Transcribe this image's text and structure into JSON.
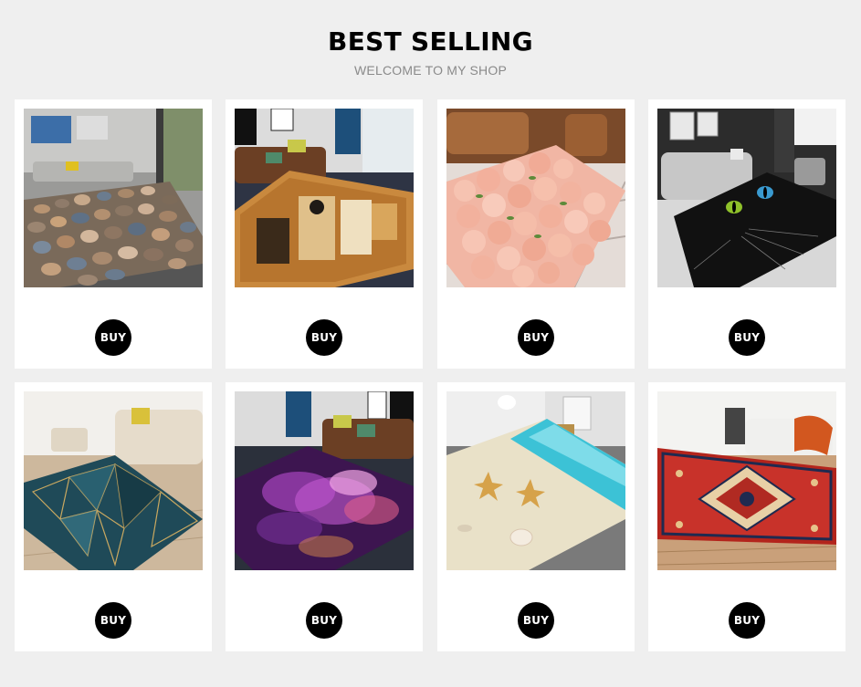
{
  "header": {
    "title": "BEST SELLING",
    "subtitle": "WELCOME TO MY SHOP"
  },
  "products": [
    {
      "image": "pebble-stones-rug-photo",
      "buy_label": "BUY"
    },
    {
      "image": "egyptian-pattern-rug-photo",
      "buy_label": "BUY"
    },
    {
      "image": "pink-roses-rug-photo",
      "buy_label": "BUY"
    },
    {
      "image": "black-cat-eyes-rug-photo",
      "buy_label": "BUY"
    },
    {
      "image": "blue-geometric-marble-rug-photo",
      "buy_label": "BUY"
    },
    {
      "image": "purple-galaxy-rug-photo",
      "buy_label": "BUY"
    },
    {
      "image": "beach-starfish-rug-photo",
      "buy_label": "BUY"
    },
    {
      "image": "red-persian-rug-photo",
      "buy_label": "BUY"
    }
  ]
}
